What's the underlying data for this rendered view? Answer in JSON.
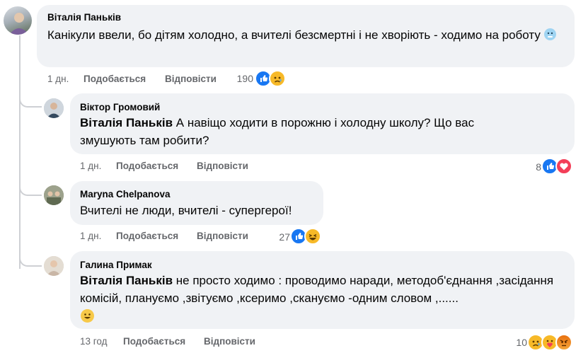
{
  "comments": [
    {
      "author": "Віталія Паньків",
      "text": "Канікули ввели, бо дітям холодно, а вчителі безсмертні і не хворіють - ходимо на роботу",
      "emoji": "cold-face-emoji",
      "time": "1 дн.",
      "like_label": "Подобається",
      "reply_label": "Відповісти",
      "reaction_count": "190",
      "reactions": [
        "like",
        "sad"
      ]
    },
    {
      "author": "Віктор Громовий",
      "mention": "Віталія Паньків",
      "text": " А навіщо ходити в порожню і холодну школу? Що вас змушують там робити?",
      "time": "1 дн.",
      "like_label": "Подобається",
      "reply_label": "Відповісти",
      "reaction_count": "8",
      "reactions": [
        "like",
        "love"
      ]
    },
    {
      "author": "Maryna Chelpanova",
      "text": "Вчителі не люди, вчителі - супергерої!",
      "time": "1 дн.",
      "like_label": "Подобається",
      "reply_label": "Відповісти",
      "reaction_count": "27",
      "reactions": [
        "like",
        "haha"
      ]
    },
    {
      "author": "Галина Примак",
      "mention": "Віталія Паньків",
      "text": " не просто ходимо : проводимо наради, методоб'єднання ,засідання комісій, плануємо ,звітуємо ,ксеримо ,скануємо -одним словом ,......",
      "emoji": "grinning-face-emoji",
      "time": "13 год",
      "like_label": "Подобається",
      "reply_label": "Відповісти",
      "reaction_count": "10",
      "reactions": [
        "sad",
        "care",
        "angry"
      ]
    }
  ],
  "colors": {
    "bubble": "#f0f2f5",
    "meta_text": "#65676b",
    "like": "#1877f2",
    "love": "#f33e58",
    "haha": "#f7b928"
  }
}
